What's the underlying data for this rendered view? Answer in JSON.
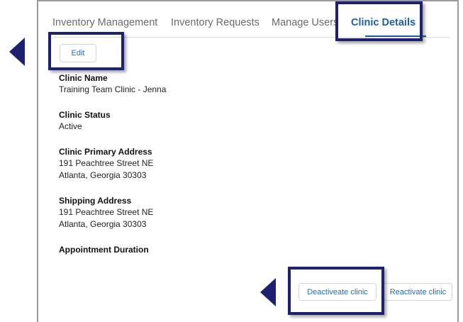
{
  "tabs": [
    {
      "label": "Inventory Management",
      "active": false
    },
    {
      "label": "Inventory Requests",
      "active": false
    },
    {
      "label": "Manage Users",
      "active": false
    },
    {
      "label": "Clinic Details",
      "active": true
    }
  ],
  "edit_button": "Edit",
  "fields": {
    "clinic_name": {
      "label": "Clinic Name",
      "value": "Training Team Clinic - Jenna"
    },
    "clinic_status": {
      "label": "Clinic Status",
      "value": "Active"
    },
    "primary_address": {
      "label": "Clinic Primary Address",
      "line1": "191 Peachtree Street NE",
      "line2": "Atlanta, Georgia 30303"
    },
    "shipping_address": {
      "label": "Shipping Address",
      "line1": "191 Peachtree Street NE",
      "line2": "Atlanta, Georgia 30303"
    },
    "appointment_duration": {
      "label": "Appointment Duration"
    }
  },
  "actions": {
    "deactivate": "Deactiveate clinic",
    "reactivate": "Reactivate clinic"
  },
  "colors": {
    "accent": "#1f5faa",
    "highlight": "#1e2172"
  }
}
